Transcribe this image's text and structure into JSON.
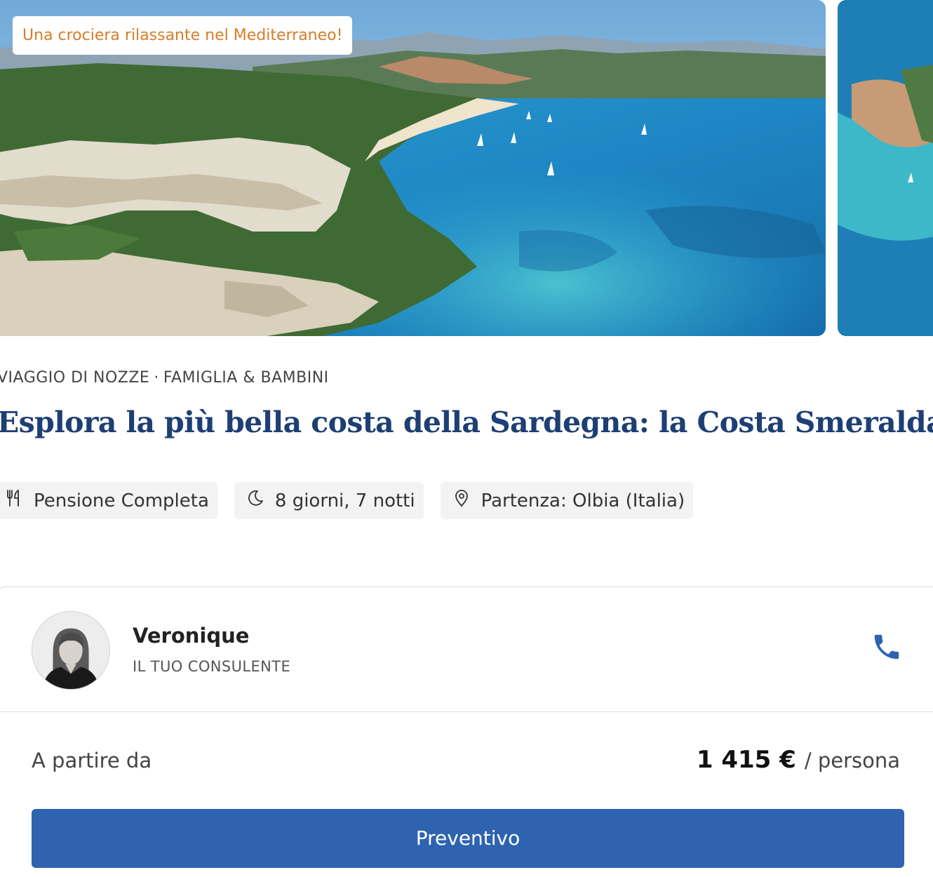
{
  "gallery": {
    "promo_badge": "Una crociera rilassante nel Mediterraneo!",
    "colors": {
      "sea": "#1e86c3",
      "shallow": "#3fb6cf",
      "forest": "#3f6a34",
      "rock": "#e2dccd"
    }
  },
  "trip": {
    "categories": [
      "VIAGGIO DI NOZZE",
      "FAMIGLIA & BAMBINI"
    ],
    "category_separator": "·",
    "title": "Esplora la più bella costa della Sardegna: la Costa Smeralda",
    "features": [
      {
        "icon": "cutlery-icon",
        "label": "Pensione Completa"
      },
      {
        "icon": "moon-icon",
        "label": "8 giorni, 7 notti"
      },
      {
        "icon": "location-pin-icon",
        "label": "Partenza: Olbia (Italia)"
      }
    ]
  },
  "advisor": {
    "name": "Veronique",
    "role": "IL TUO CONSULENTE",
    "phone_icon": "phone-icon"
  },
  "pricing": {
    "from_label": "A partire da",
    "price": "1 415 €",
    "unit": "/ persona"
  },
  "cta": {
    "label": "Preventivo",
    "color": "#2e63b0"
  }
}
